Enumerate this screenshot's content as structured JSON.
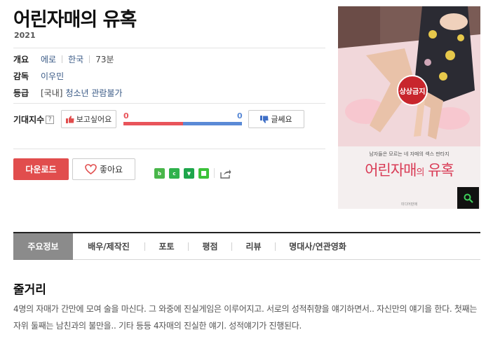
{
  "movie": {
    "title": "어린자매의 유혹",
    "year": "2021"
  },
  "info": {
    "overview_label": "개요",
    "genre": "에로",
    "country": "한국",
    "runtime": "73분",
    "director_label": "감독",
    "director": "이우민",
    "rating_label": "등급",
    "rating_region": "[국내]",
    "rating": "청소년 관람불가"
  },
  "expectation": {
    "label": "기대지수",
    "help": "?",
    "want_label": "보고싶어요",
    "want_count": "0",
    "meh_label": "글쎄요",
    "meh_count": "0",
    "want_color": "#e9545a",
    "meh_color": "#5a8ad6"
  },
  "actions": {
    "download_label": "다운로드",
    "like_label": "좋아요",
    "share_icons": [
      "blog-icon",
      "cafe-icon",
      "bookmark-icon",
      "memo-icon",
      "share-icon"
    ]
  },
  "poster": {
    "badge": "상상금지",
    "tagline": "남자들은 모르는 네 자매의 섹스 판타지",
    "title_main": "어린자매",
    "title_particle": "의",
    "title_end": " 유혹",
    "fine_print": "미디어판매"
  },
  "tabs": [
    {
      "label": "주요정보"
    },
    {
      "label": "배우/제작진"
    },
    {
      "label": "포토"
    },
    {
      "label": "평점"
    },
    {
      "label": "리뷰"
    },
    {
      "label": "명대사/연관영화"
    }
  ],
  "synopsis": {
    "heading": "줄거리",
    "text": "4명의 자매가 간만에 모여 술을 마신다. 그 와중에 진실게임은 이루어지고. 서로의 성적취향을 얘기하면서.. 자신만의 얘기을 한다. 첫째는 자위 둘째는 남친과의 불만을.. 기타 등등 4자매의 진실한 얘기. 성적얘기가 진행된다."
  },
  "colors": {
    "download_bg": "#e14d4d",
    "active_tab_bg": "#8b8b8b",
    "link": "#3a5a86"
  }
}
